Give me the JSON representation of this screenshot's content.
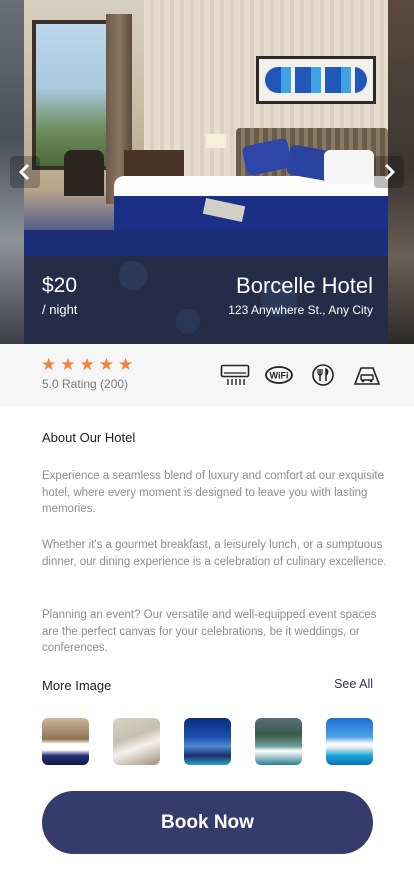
{
  "hero": {
    "price": "$20",
    "per_night": "/ night",
    "hotel_name": "Borcelle Hotel",
    "address": "123 Anywhere St., Any City",
    "prev_icon": "chevron-left-icon",
    "next_icon": "chevron-right-icon"
  },
  "rating": {
    "stars": 5,
    "text": "5.0 Rating (200)",
    "star_color": "#f0823b"
  },
  "amenities": [
    {
      "icon": "air-conditioner-icon"
    },
    {
      "icon": "wifi-icon",
      "label": "WiFi"
    },
    {
      "icon": "restaurant-icon"
    },
    {
      "icon": "parking-icon"
    }
  ],
  "about": {
    "title": "About Our Hotel",
    "paragraphs": [
      "Experience a seamless blend of luxury and comfort at our exquisite hotel, where every moment is designed to leave you with lasting memories.",
      "Whether it's a gourmet breakfast, a leisurely lunch, or a sumptuous dinner, our dining experience is a celebration of culinary excellence.",
      "Planning an event? Our versatile and well-equipped event spaces are the perfect canvas for your celebrations, be it weddings, or conferences."
    ]
  },
  "gallery": {
    "title": "More Image",
    "see_all": "See All"
  },
  "cta": {
    "label": "Book Now",
    "color": "#353c6b"
  }
}
